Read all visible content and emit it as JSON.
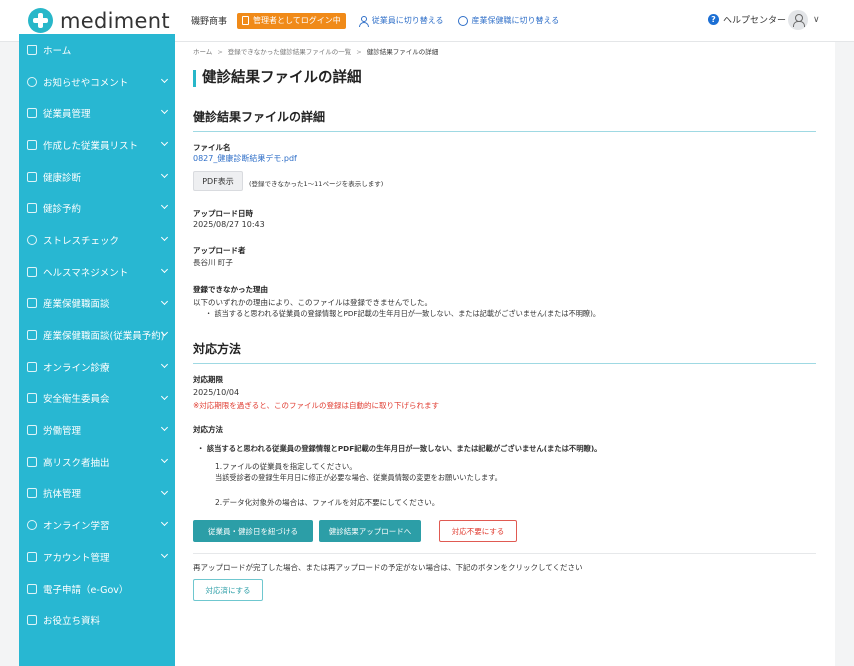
{
  "header": {
    "logo_text": "mediment",
    "company": "磯野商事",
    "admin_login": "管理者としてログイン中",
    "switch_employee": "従業員に切り替える",
    "switch_doctor": "産業保健職に切り替える",
    "help": "ヘルプセンター",
    "help_icon_glyph": "?",
    "caret_glyph": "∨"
  },
  "sidebar": {
    "items": [
      {
        "label": "ホーム",
        "icon": "home-icon"
      },
      {
        "label": "お知らせやコメント",
        "icon": "bell-icon"
      },
      {
        "label": "従業員管理",
        "icon": "users-icon"
      },
      {
        "label": "作成した従業員リスト",
        "icon": "list-icon"
      },
      {
        "label": "健康診断",
        "icon": "stethoscope-icon"
      },
      {
        "label": "健診予約",
        "icon": "calendar-icon"
      },
      {
        "label": "ストレスチェック",
        "icon": "heart-icon"
      },
      {
        "label": "ヘルスマネジメント",
        "icon": "health-icon"
      },
      {
        "label": "産業保健職面談",
        "icon": "meeting-icon"
      },
      {
        "label": "産業保健職面談(従業員予約)",
        "icon": "meeting-icon"
      },
      {
        "label": "オンライン診療",
        "icon": "monitor-icon"
      },
      {
        "label": "安全衛生委員会",
        "icon": "document-icon"
      },
      {
        "label": "労働管理",
        "icon": "clock-icon"
      },
      {
        "label": "高リスク者抽出",
        "icon": "risk-icon"
      },
      {
        "label": "抗体管理",
        "icon": "syringe-icon"
      },
      {
        "label": "オンライン学習",
        "icon": "learning-icon"
      },
      {
        "label": "アカウント管理",
        "icon": "gear-icon"
      },
      {
        "label": "電子申請（e-Gov）",
        "icon": "application-icon"
      },
      {
        "label": "お役立ち資料",
        "icon": "book-icon"
      }
    ]
  },
  "breadcrumb": {
    "home": "ホーム",
    "list": "登録できなかった健診結果ファイルの一覧",
    "current": "健診結果ファイルの詳細",
    "sep": ">"
  },
  "page_title": "健診結果ファイルの詳細",
  "detail": {
    "section_title": "健診結果ファイルの詳細",
    "file_name_label": "ファイル名",
    "file_name": "0827_健康診断結果デモ.pdf",
    "pdf_button": "PDF表示",
    "pdf_note": "(登録できなかった1〜11ページを表示します)",
    "upload_date_label": "アップロード日時",
    "upload_date": "2025/08/27 10:43",
    "uploader_label": "アップロード者",
    "uploader": "長谷川 町子",
    "reason_label": "登録できなかった理由",
    "reason_text": "以下のいずれかの理由により、このファイルは登録できませんでした。",
    "reason_bullet": "・ 該当すると思われる従業員の登録情報とPDF記載の生年月日が一致しない、または記載がございません(または不明瞭)。"
  },
  "action": {
    "section_title": "対応方法",
    "deadline_label": "対応期限",
    "deadline": "2025/10/04",
    "deadline_warning": "※対応期限を過ぎると、このファイルの登録は自動的に取り下げられます",
    "method_label": "対応方法",
    "method_heading": "・ 該当すると思われる従業員の登録情報とPDF記載の生年月日が一致しない、または記載がございません(または不明瞭)。",
    "step1": "1.ファイルの従業員を指定してください。",
    "step1_note": "当該受診者の登録生年月日に修正が必要な場合、従業員情報の変更をお願いいたします。",
    "step2": "2.データ化対象外の場合は、ファイルを対応不要にしてください。",
    "btn_link": "従業員・健診日を紐づける",
    "btn_upload": "健診結果アップロードへ",
    "btn_unneeded": "対応不要にする",
    "reupload_note": "再アップロードが完了した場合、または再アップロードの予定がない場合は、下記のボタンをクリックしてください",
    "btn_done": "対応済にする"
  },
  "colors": {
    "accent": "#28b7d2",
    "admin_badge": "#f08a18",
    "warning": "#e03c31",
    "button_teal": "#2c9ea7"
  }
}
